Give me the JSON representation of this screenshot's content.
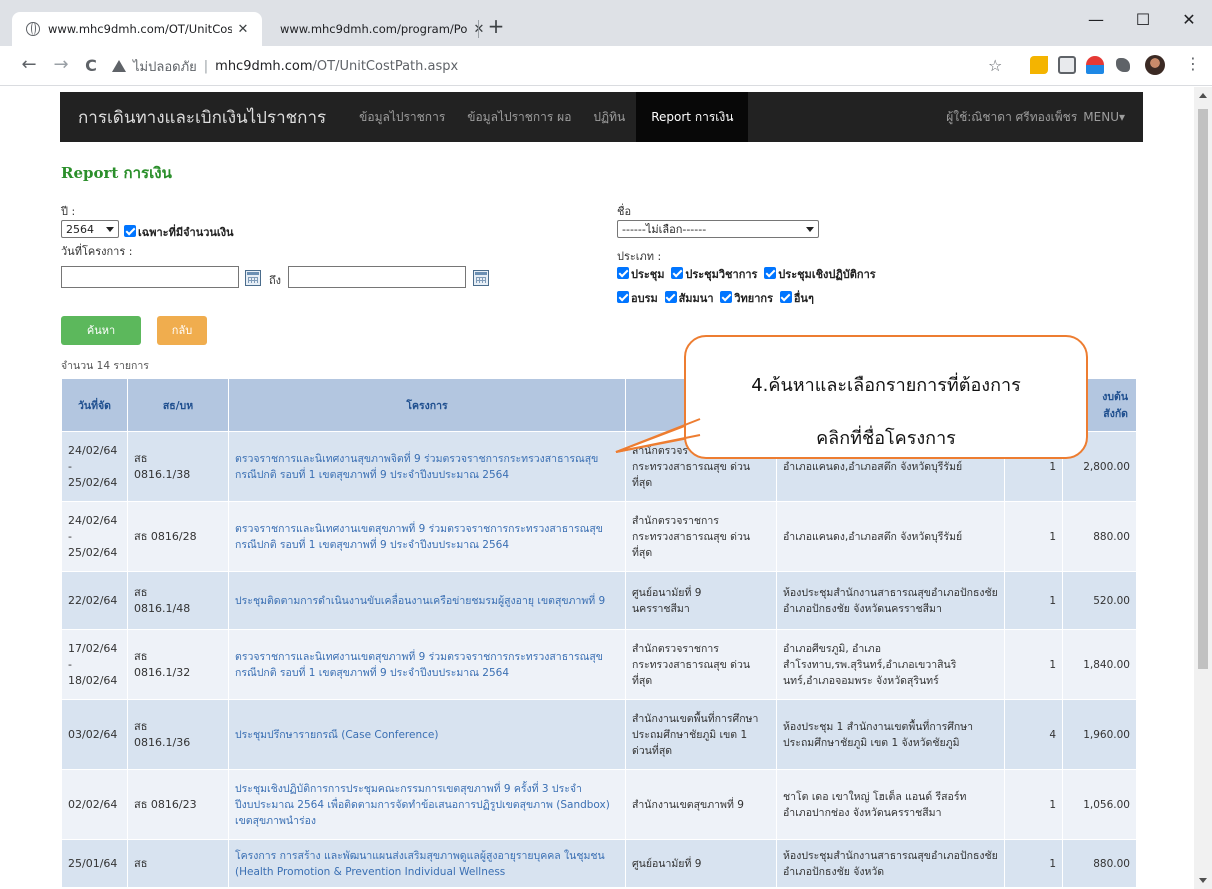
{
  "browser": {
    "tabs": [
      {
        "title": "www.mhc9dmh.com/OT/UnitCos"
      },
      {
        "title": "www.mhc9dmh.com/program/Po"
      }
    ],
    "new_tab": "+",
    "close_glyph": "✕",
    "window": {
      "minimize": "—",
      "maximize": "☐",
      "close": "✕"
    },
    "nav": {
      "back": "←",
      "forward": "→",
      "reload": "C"
    },
    "address": {
      "insecure": "ไม่ปลอดภัย",
      "separator": "|",
      "host": "mhc9dmh.com",
      "path": "/OT/UnitCostPath.aspx"
    },
    "bookmark": "☆",
    "menu": "⋮"
  },
  "navbar": {
    "brand": "การเดินทางและเบิกเงินไปราชการ",
    "items": [
      "ข้อมูลไปราชการ",
      "ข้อมูลไปราชการ ผอ",
      "ปฏิทิน",
      "Report การเงิน"
    ],
    "user": "ผู้ใช้:ณิชาดา ศรีทองเพ็ชร",
    "menu": "MENU▾"
  },
  "page": {
    "title": "Report การเงิน"
  },
  "filters": {
    "year_label": "ปี :",
    "year_value": "2564",
    "money_only": "เฉพาะที่มีจำนวนเงิน",
    "project_date_label": "วันที่โครงการ :",
    "to_label": "ถึง",
    "name_label": "ชื่อ",
    "name_value": "------ไม่เลือก------",
    "type_label": "ประเภท :",
    "types_row1": [
      "ประชุม",
      "ประชุมวิชาการ",
      "ประชุมเชิงปฏิบัติการ"
    ],
    "types_row2": [
      "อบรม",
      "สัมมนา",
      "วิทยากร",
      "อื่นๆ"
    ]
  },
  "buttons": {
    "search": "ค้นหา",
    "back": "กลับ"
  },
  "count": "จำนวน 14 รายการ",
  "table": {
    "headers": [
      "วันที่จัด",
      "สธ/บห",
      "โครงการ",
      "",
      "",
      "",
      "งบต้น\nสังกัด"
    ],
    "rows": [
      {
        "date": "24/02/64\n-\n25/02/64",
        "doc": "สธ\n0816.1/38",
        "project": "ตรวจราชการและนิเทศงานสุขภาพจิตที่ 9 ร่วมตรวจราชการกระทรวงสาธารณสุข กรณีปกติ รอบที่ 1 เขตสุขภาพที่ 9 ประจำปีงบประมาณ 2564",
        "org": "สำนักตรวจราชการ\nกระทรวงสาธารณสุข ด่วนที่สุด",
        "place": "อำเภอแคนดง,อำเภอสตึก จังหวัดบุรีรัมย์",
        "qty": "1",
        "amount": "2,800.00"
      },
      {
        "date": "24/02/64\n-\n25/02/64",
        "doc": "สธ 0816/28",
        "project": "ตรวจราชการและนิเทศงานเขตสุขภาพที่ 9 ร่วมตรวจราชการกระทรวงสาธารณสุข กรณีปกติ รอบที่ 1 เขตสุขภาพที่ 9 ประจำปีงบประมาณ 2564",
        "org": "สำนักตรวจราชการ\nกระทรวงสาธารณสุข ด่วนที่สุด",
        "place": "อำเภอแคนดง,อำเภอสตึก จังหวัดบุรีรัมย์",
        "qty": "1",
        "amount": "880.00"
      },
      {
        "date": "22/02/64",
        "doc": "สธ\n0816.1/48",
        "project": "ประชุมติดตามการดำเนินงานขับเคลื่อนงานเครือข่ายชมรมผู้สูงอายุ เขตสุขภาพที่ 9",
        "org": "ศูนย์อนามัยที่ 9\nนครราชสีมา",
        "place": "ห้องประชุมสำนักงานสาธารณสุขอำเภอปักธงชัย อำเภอปักธงชัย จังหวัดนครราชสีมา",
        "qty": "1",
        "amount": "520.00"
      },
      {
        "date": "17/02/64\n-\n18/02/64",
        "doc": "สธ\n0816.1/32",
        "project": "ตรวจราชการและนิเทศงานเขตสุขภาพที่ 9 ร่วมตรวจราชการกระทรวงสาธารณสุข กรณีปกติ รอบที่ 1 เขตสุขภาพที่ 9 ประจำปีงบประมาณ 2564",
        "org": "สำนักตรวจราชการ\nกระทรวงสาธารณสุข ด่วนที่สุด",
        "place": "อำเภอศีขรภูมิ, อำเภอสำโรงทาบ,รพ.สุรินทร์,อำเภอเขวาสินรินทร์,อำเภอจอมพระ จังหวัดสุรินทร์",
        "qty": "1",
        "amount": "1,840.00"
      },
      {
        "date": "03/02/64",
        "doc": "สธ\n0816.1/36",
        "project": "ประชุมปรึกษารายกรณี (Case Conference)",
        "org": "สำนักงานเขตพื้นที่การศึกษาประถมศึกษาชัยภูมิ เขต 1 ด่วนที่สุด",
        "place": "ห้องประชุม 1 สำนักงานเขตพื้นที่การศึกษาประถมศึกษาชัยภูมิ เขต 1 จังหวัดชัยภูมิ",
        "qty": "4",
        "amount": "1,960.00"
      },
      {
        "date": "02/02/64",
        "doc": "สธ 0816/23",
        "project": "ประชุมเชิงปฏิบัติการการประชุมคณะกรรมการเขตสุขภาพที่ 9 ครั้งที่ 3 ประจำปีงบประมาณ 2564 เพื่อติดตามการจัดทำข้อเสนอการปฏิรูปเขตสุขภาพ (Sandbox) เขตสุขภาพนำร่อง",
        "org": "สำนักงานเขตสุขภาพที่ 9",
        "place": "ชาโต เดอ เขาใหญ่ โฮเต็ล แอนด์ รีสอร์ท อำเภอปากช่อง จังหวัดนครราชสีมา",
        "qty": "1",
        "amount": "1,056.00"
      },
      {
        "date": "25/01/64",
        "doc": "สธ",
        "project": "โครงการ การสร้าง และพัฒนาแผนส่งเสริมสุขภาพดูแลผู้สูงอายุรายบุคคล ในชุมชน (Health Promotion & Prevention Individual Wellness",
        "org": "ศูนย์อนามัยที่ 9",
        "place": "ห้องประชุมสำนักงานสาธารณสุขอำเภอปักธงชัย อำเภอปักธงชัย จังหวัด",
        "qty": "1",
        "amount": "880.00"
      }
    ]
  },
  "callout": {
    "line1": "4.ค้นหาและเลือกรายการที่ต้องการ",
    "line2": "คลิกที่ชื่อโครงการ",
    "border_color": "#ed7d31"
  },
  "colors": {
    "navbar_bg": "#222222",
    "title_green": "#2b8f2b",
    "btn_search": "#5cb85c",
    "btn_back": "#f0ad4e",
    "header_bg": "#b3c6e0",
    "link": "#3a6fb3"
  }
}
